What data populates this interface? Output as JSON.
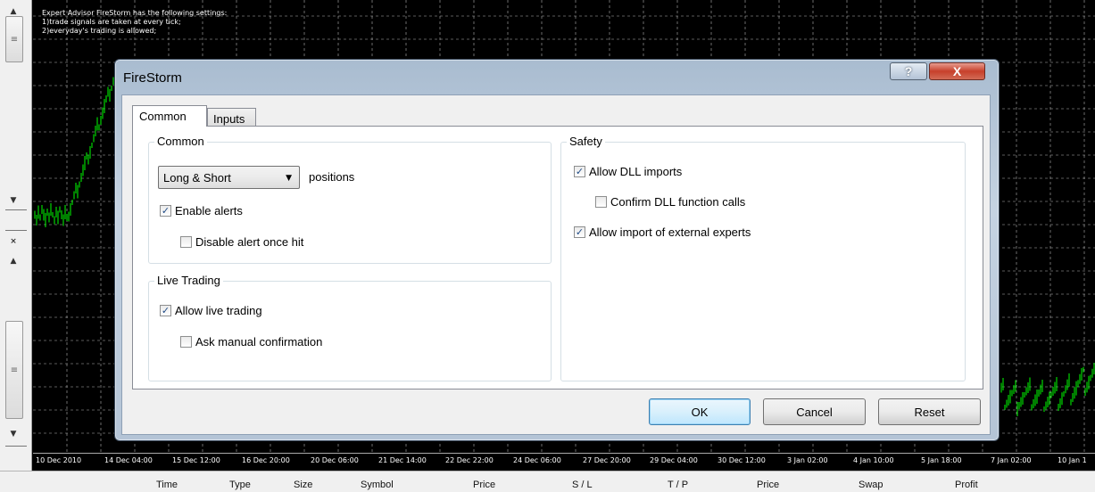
{
  "chart": {
    "expert_info": [
      "Expert Advisor FireStorm has the following settings:",
      "1)trade signals are taken at every tick;",
      "2)everyday's trading is allowed;"
    ],
    "time_labels": [
      "10 Dec 2010",
      "14 Dec 04:00",
      "15 Dec 12:00",
      "16 Dec 20:00",
      "20 Dec 06:00",
      "21 Dec 14:00",
      "22 Dec 22:00",
      "24 Dec 06:00",
      "27 Dec 20:00",
      "29 Dec 04:00",
      "30 Dec 12:00",
      "3 Jan 02:00",
      "4 Jan 10:00",
      "5 Jan 18:00",
      "7 Jan 02:00",
      "10 Jan 1"
    ],
    "colors": {
      "background": "#000000",
      "candles": "#00ff00",
      "grid": "#b4b4b4"
    }
  },
  "left_panel": {
    "icons": [
      "scroll-up-icon",
      "scroll-thumb-grip-icon",
      "scroll-down-icon",
      "close-icon",
      "scroll-up-icon",
      "scroll-thumb-grip-icon",
      "scroll-down-icon"
    ]
  },
  "dialog": {
    "title": "FireStorm",
    "help_label": "?",
    "close_label": "X",
    "tabs": [
      {
        "label": "Common",
        "active": true
      },
      {
        "label": "Inputs",
        "active": false
      }
    ],
    "common_group": {
      "title": "Common",
      "positions_select": {
        "value": "Long & Short",
        "suffix": "positions"
      },
      "enable_alerts": {
        "label": "Enable alerts",
        "checked": true
      },
      "disable_alert_once_hit": {
        "label": "Disable alert once hit",
        "checked": false
      }
    },
    "live_trading_group": {
      "title": "Live Trading",
      "allow_live_trading": {
        "label": "Allow live trading",
        "checked": true
      },
      "ask_manual_confirmation": {
        "label": "Ask manual confirmation",
        "checked": false
      }
    },
    "safety_group": {
      "title": "Safety",
      "allow_dll_imports": {
        "label": "Allow DLL imports",
        "checked": true
      },
      "confirm_dll_calls": {
        "label": "Confirm DLL function calls",
        "checked": false
      },
      "allow_external_experts": {
        "label": "Allow import of external experts",
        "checked": true
      }
    },
    "buttons": {
      "ok": "OK",
      "cancel": "Cancel",
      "reset": "Reset"
    }
  },
  "terminal": {
    "columns": [
      "Time",
      "Type",
      "Size",
      "Symbol",
      "Price",
      "S / L",
      "T / P",
      "Price",
      "Swap",
      "Profit"
    ]
  }
}
